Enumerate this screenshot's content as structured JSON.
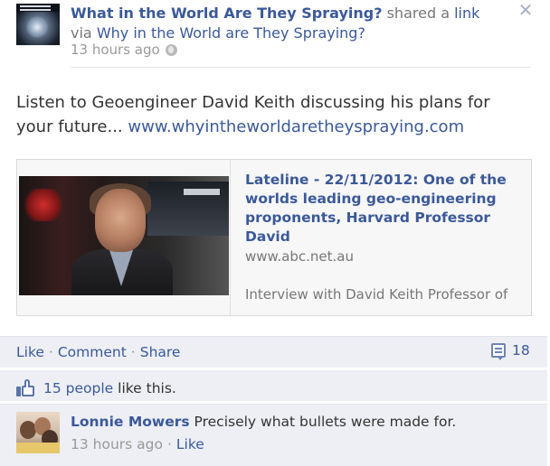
{
  "post": {
    "author": "What in the World Are They Spraying?",
    "action_text": "shared a",
    "link_word": "link",
    "via_text": "via",
    "via_page": "Why in the World are They Spraying?",
    "time": "13 hours ago",
    "message": "Listen to Geoengineer David Keith discussing his plans for your future...",
    "message_link": "www.whyintheworldaretheyspraying.com"
  },
  "preview": {
    "title": "Lateline - 22/11/2012: One of the worlds leading geo-engineering proponents, Harvard Professor David",
    "domain": "www.abc.net.au",
    "description": "Interview with David Keith Professor of"
  },
  "actions": {
    "like": "Like",
    "comment": "Comment",
    "share": "Share",
    "comment_count": "18",
    "dot": "·"
  },
  "likes": {
    "count_link": "15 people",
    "suffix": "like this."
  },
  "comment": {
    "author": "Lonnie Mowers",
    "text": "Precisely what bullets were made for.",
    "time": "13 hours ago",
    "like": "Like"
  },
  "icons": {
    "close": "close-icon",
    "globe": "globe-icon",
    "thumbs_up": "thumbs-up-icon",
    "comment": "comment-icon"
  },
  "colors": {
    "link": "#3b5998",
    "muted": "#999999",
    "footer_bg": "#edeff4"
  }
}
